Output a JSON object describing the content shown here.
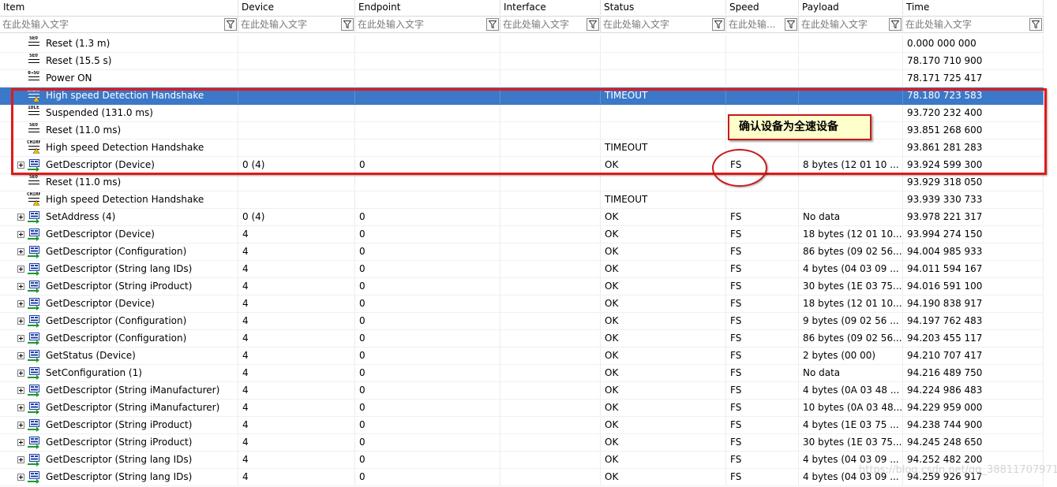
{
  "columns": [
    {
      "label": "Item",
      "placeholder": "在此处输入文字"
    },
    {
      "label": "Device",
      "placeholder": "在此处输入文字"
    },
    {
      "label": "Endpoint",
      "placeholder": "在此处输入文字"
    },
    {
      "label": "Interface",
      "placeholder": "在此处输入文字"
    },
    {
      "label": "Status",
      "placeholder": "在此处输入文字"
    },
    {
      "label": "Speed",
      "placeholder": "在此处输..."
    },
    {
      "label": "Payload",
      "placeholder": "在此处输入文字"
    },
    {
      "label": "Time",
      "placeholder": "在此处输入文字"
    }
  ],
  "rows": [
    {
      "icon": "reset-icon",
      "expandable": false,
      "selected": false,
      "item": "Reset (1.3 m)",
      "device": "",
      "endpoint": "",
      "interface": "",
      "status": "",
      "speed": "",
      "payload": "",
      "time": "0.000 000 000"
    },
    {
      "icon": "reset-icon",
      "expandable": false,
      "selected": false,
      "item": "Reset (15.5 s)",
      "device": "",
      "endpoint": "",
      "interface": "",
      "status": "",
      "speed": "",
      "payload": "",
      "time": "78.170 710 900"
    },
    {
      "icon": "power-on-icon",
      "expandable": false,
      "selected": false,
      "item": "Power ON",
      "device": "",
      "endpoint": "",
      "interface": "",
      "status": "",
      "speed": "",
      "payload": "",
      "time": "78.171 725 417"
    },
    {
      "icon": "chirp-warning-icon",
      "expandable": false,
      "selected": true,
      "item": "High speed Detection Handshake",
      "device": "",
      "endpoint": "",
      "interface": "",
      "status": "TIMEOUT",
      "speed": "",
      "payload": "",
      "time": "78.180 723 583"
    },
    {
      "icon": "idle-icon",
      "expandable": false,
      "selected": false,
      "item": "Suspended (131.0 ms)",
      "device": "",
      "endpoint": "",
      "interface": "",
      "status": "",
      "speed": "",
      "payload": "",
      "time": "93.720 232 400"
    },
    {
      "icon": "reset-icon",
      "expandable": false,
      "selected": false,
      "item": "Reset (11.0 ms)",
      "device": "",
      "endpoint": "",
      "interface": "",
      "status": "",
      "speed": "",
      "payload": "",
      "time": "93.851 268 600"
    },
    {
      "icon": "chirp-warning-icon",
      "expandable": false,
      "selected": false,
      "item": "High speed Detection Handshake",
      "device": "",
      "endpoint": "",
      "interface": "",
      "status": "TIMEOUT",
      "speed": "",
      "payload": "",
      "time": "93.861 281 283"
    },
    {
      "icon": "control-transfer-icon",
      "expandable": true,
      "selected": false,
      "item": "GetDescriptor (Device)",
      "device": "0 (4)",
      "endpoint": "0",
      "interface": "",
      "status": "OK",
      "speed": "FS",
      "payload": "8 bytes (12 01 10 ...",
      "time": "93.924 599 300"
    },
    {
      "icon": "reset-icon",
      "expandable": false,
      "selected": false,
      "item": "Reset (11.0 ms)",
      "device": "",
      "endpoint": "",
      "interface": "",
      "status": "",
      "speed": "",
      "payload": "",
      "time": "93.929 318 050"
    },
    {
      "icon": "chirp-warning-icon",
      "expandable": false,
      "selected": false,
      "item": "High speed Detection Handshake",
      "device": "",
      "endpoint": "",
      "interface": "",
      "status": "TIMEOUT",
      "speed": "",
      "payload": "",
      "time": "93.939 330 733"
    },
    {
      "icon": "control-transfer-icon",
      "expandable": true,
      "selected": false,
      "item": "SetAddress (4)",
      "device": "0 (4)",
      "endpoint": "0",
      "interface": "",
      "status": "OK",
      "speed": "FS",
      "payload": "No data",
      "time": "93.978 221 317"
    },
    {
      "icon": "control-transfer-icon",
      "expandable": true,
      "selected": false,
      "item": "GetDescriptor (Device)",
      "device": "4",
      "endpoint": "0",
      "interface": "",
      "status": "OK",
      "speed": "FS",
      "payload": "18 bytes (12 01 10...",
      "time": "93.994 274 150"
    },
    {
      "icon": "control-transfer-icon",
      "expandable": true,
      "selected": false,
      "item": "GetDescriptor (Configuration)",
      "device": "4",
      "endpoint": "0",
      "interface": "",
      "status": "OK",
      "speed": "FS",
      "payload": "86 bytes (09 02 56...",
      "time": "94.004 985 933"
    },
    {
      "icon": "control-transfer-icon",
      "expandable": true,
      "selected": false,
      "item": "GetDescriptor (String lang IDs)",
      "device": "4",
      "endpoint": "0",
      "interface": "",
      "status": "OK",
      "speed": "FS",
      "payload": "4 bytes (04 03 09 ...",
      "time": "94.011 594 167"
    },
    {
      "icon": "control-transfer-icon",
      "expandable": true,
      "selected": false,
      "item": "GetDescriptor (String iProduct)",
      "device": "4",
      "endpoint": "0",
      "interface": "",
      "status": "OK",
      "speed": "FS",
      "payload": "30 bytes (1E 03 75...",
      "time": "94.016 591 100"
    },
    {
      "icon": "control-transfer-icon",
      "expandable": true,
      "selected": false,
      "item": "GetDescriptor (Device)",
      "device": "4",
      "endpoint": "0",
      "interface": "",
      "status": "OK",
      "speed": "FS",
      "payload": "18 bytes (12 01 10...",
      "time": "94.190 838 917"
    },
    {
      "icon": "control-transfer-icon",
      "expandable": true,
      "selected": false,
      "item": "GetDescriptor (Configuration)",
      "device": "4",
      "endpoint": "0",
      "interface": "",
      "status": "OK",
      "speed": "FS",
      "payload": "9 bytes (09 02 56 ...",
      "time": "94.197 762 483"
    },
    {
      "icon": "control-transfer-icon",
      "expandable": true,
      "selected": false,
      "item": "GetDescriptor (Configuration)",
      "device": "4",
      "endpoint": "0",
      "interface": "",
      "status": "OK",
      "speed": "FS",
      "payload": "86 bytes (09 02 56...",
      "time": "94.203 455 117"
    },
    {
      "icon": "control-transfer-icon",
      "expandable": true,
      "selected": false,
      "item": "GetStatus (Device)",
      "device": "4",
      "endpoint": "0",
      "interface": "",
      "status": "OK",
      "speed": "FS",
      "payload": "2 bytes (00 00)",
      "time": "94.210 707 417"
    },
    {
      "icon": "control-transfer-icon",
      "expandable": true,
      "selected": false,
      "item": "SetConfiguration (1)",
      "device": "4",
      "endpoint": "0",
      "interface": "",
      "status": "OK",
      "speed": "FS",
      "payload": "No data",
      "time": "94.216 489 750"
    },
    {
      "icon": "control-transfer-icon",
      "expandable": true,
      "selected": false,
      "item": "GetDescriptor (String iManufacturer)",
      "device": "4",
      "endpoint": "0",
      "interface": "",
      "status": "OK",
      "speed": "FS",
      "payload": "4 bytes (0A 03 48 ...",
      "time": "94.224 986 483"
    },
    {
      "icon": "control-transfer-icon",
      "expandable": true,
      "selected": false,
      "item": "GetDescriptor (String iManufacturer)",
      "device": "4",
      "endpoint": "0",
      "interface": "",
      "status": "OK",
      "speed": "FS",
      "payload": "10 bytes (0A 03 48...",
      "time": "94.229 959 000"
    },
    {
      "icon": "control-transfer-icon",
      "expandable": true,
      "selected": false,
      "item": "GetDescriptor (String iProduct)",
      "device": "4",
      "endpoint": "0",
      "interface": "",
      "status": "OK",
      "speed": "FS",
      "payload": "4 bytes (1E 03 75 ...",
      "time": "94.238 744 900"
    },
    {
      "icon": "control-transfer-icon",
      "expandable": true,
      "selected": false,
      "item": "GetDescriptor (String iProduct)",
      "device": "4",
      "endpoint": "0",
      "interface": "",
      "status": "OK",
      "speed": "FS",
      "payload": "30 bytes (1E 03 75...",
      "time": "94.245 248 650"
    },
    {
      "icon": "control-transfer-icon",
      "expandable": true,
      "selected": false,
      "item": "GetDescriptor (String lang IDs)",
      "device": "4",
      "endpoint": "0",
      "interface": "",
      "status": "OK",
      "speed": "FS",
      "payload": "4 bytes (04 03 09 ...",
      "time": "94.252 482 200"
    },
    {
      "icon": "control-transfer-icon",
      "expandable": true,
      "selected": false,
      "item": "GetDescriptor (String lang IDs)",
      "device": "4",
      "endpoint": "0",
      "interface": "",
      "status": "OK",
      "speed": "FS",
      "payload": "4 bytes (04 03 09 ...",
      "time": "94.259 926 917"
    }
  ],
  "icon_labels": {
    "reset-icon": "SEO",
    "power-on-icon": "0→5U",
    "chirp-warning-icon": "CHIRP",
    "idle-icon": "IDLE"
  },
  "annotation": {
    "callout_text": "确认设备为全速设备"
  },
  "colors": {
    "selection": "#3c78c8",
    "annotation_red": "#e01a1a",
    "callout_bg": "#ffffcc"
  }
}
